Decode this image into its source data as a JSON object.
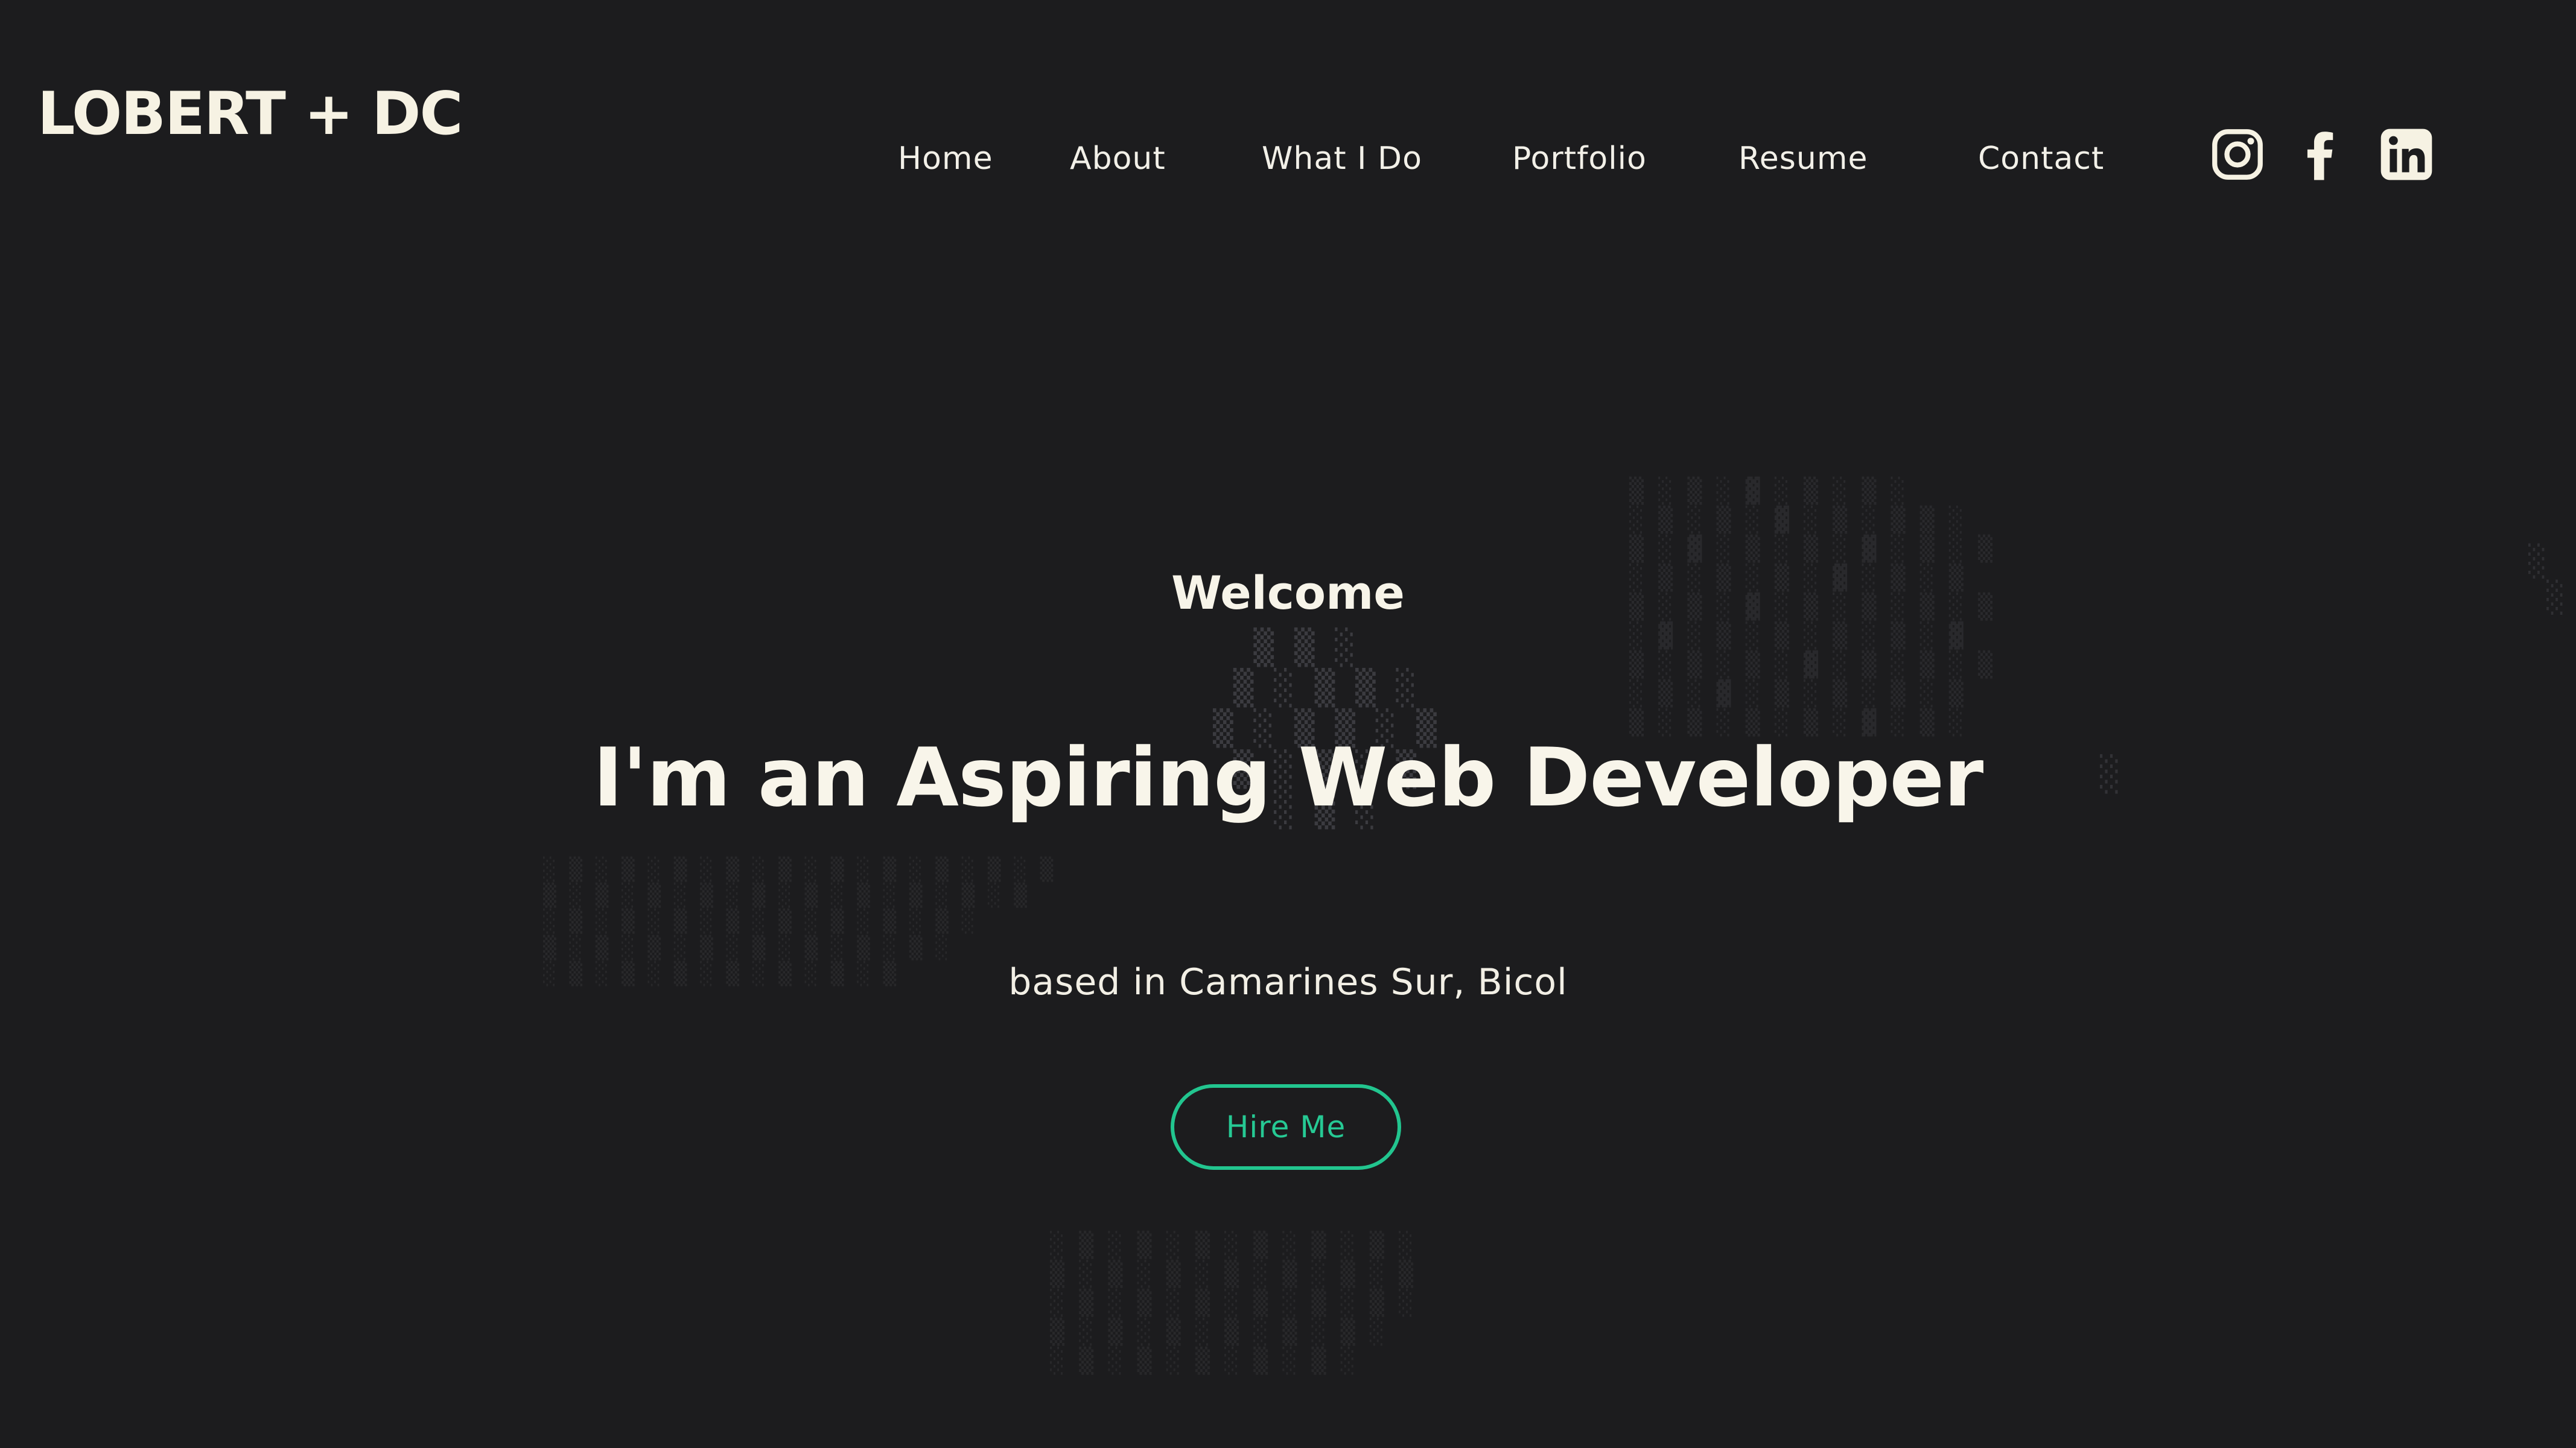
{
  "brand": {
    "logo_text": "LOBERT + DC"
  },
  "nav": {
    "items": [
      {
        "label": "Home"
      },
      {
        "label": "About"
      },
      {
        "label": "What I Do"
      },
      {
        "label": "Portfolio"
      },
      {
        "label": "Resume"
      },
      {
        "label": "Contact"
      }
    ]
  },
  "social": {
    "icons": [
      "instagram-icon",
      "facebook-icon",
      "linkedin-icon"
    ]
  },
  "hero": {
    "welcome": "Welcome",
    "headline": "I'm an Aspiring Web Developer",
    "location": "based in Camarines Sur, Bicol",
    "cta_label": "Hire Me"
  },
  "colors": {
    "background": "#1c1c1e",
    "text": "#f6f2e3",
    "accent": "#22c58f"
  }
}
